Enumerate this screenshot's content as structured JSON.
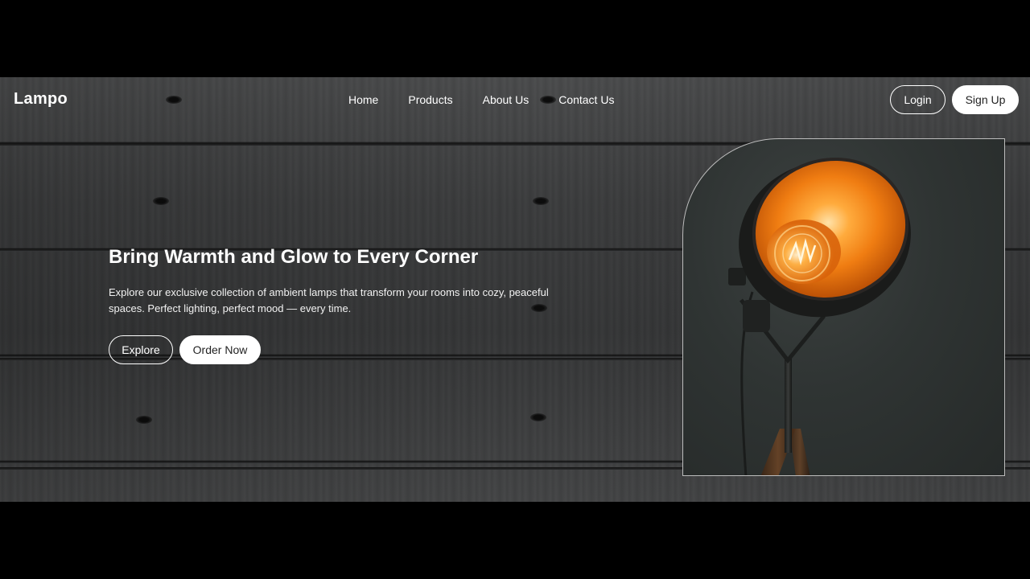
{
  "brand": {
    "logo": "Lampo"
  },
  "nav": {
    "links": [
      {
        "label": "Home"
      },
      {
        "label": "Products"
      },
      {
        "label": "About Us"
      },
      {
        "label": "Contact Us"
      }
    ],
    "login_label": "Login",
    "signup_label": "Sign Up"
  },
  "hero": {
    "title": "Bring Warmth and Glow to Every Corner",
    "description": "Explore our exclusive collection of ambient lamps that transform your rooms into cozy, peaceful spaces. Perfect lighting, perfect mood — every time.",
    "explore_label": "Explore",
    "order_label": "Order Now"
  },
  "colors": {
    "accent_orange": "#f58a1f",
    "text": "#ffffff",
    "button_solid_bg": "#ffffff"
  },
  "icons": {
    "lamp_image": "lamp-photo"
  }
}
